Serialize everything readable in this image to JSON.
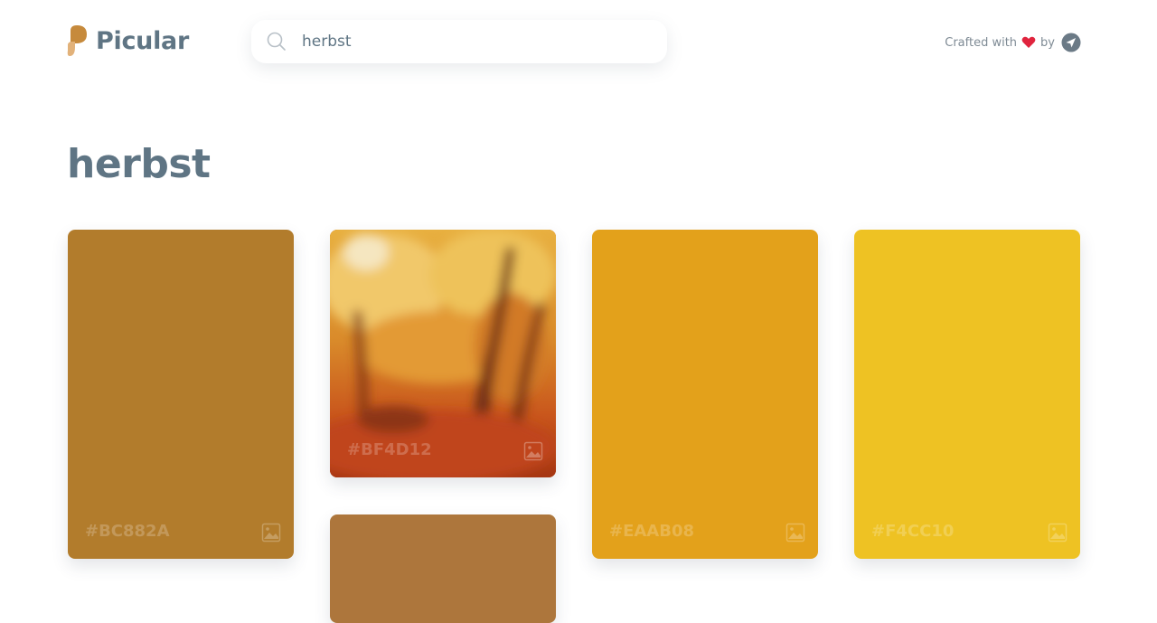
{
  "brand": {
    "name": "Picular"
  },
  "search": {
    "value": "herbst",
    "placeholder": "Search"
  },
  "credit": {
    "prefix": "Crafted with",
    "by": "by"
  },
  "page": {
    "title": "herbst"
  },
  "swatches": [
    {
      "hex": "#BC882A",
      "color": "#b27c2c"
    },
    {
      "hex": "#BF4D12",
      "color": "#bf4d12",
      "photo": "autumn forest"
    },
    {
      "hex": "",
      "color": "#ad763c"
    },
    {
      "hex": "#EAAB08",
      "color": "#e3a11b"
    },
    {
      "hex": "#F4CC10",
      "color": "#eec223"
    }
  ],
  "colors": {
    "text": "#5f7584",
    "accent": "#c68a3c",
    "heart": "#e0243e"
  }
}
